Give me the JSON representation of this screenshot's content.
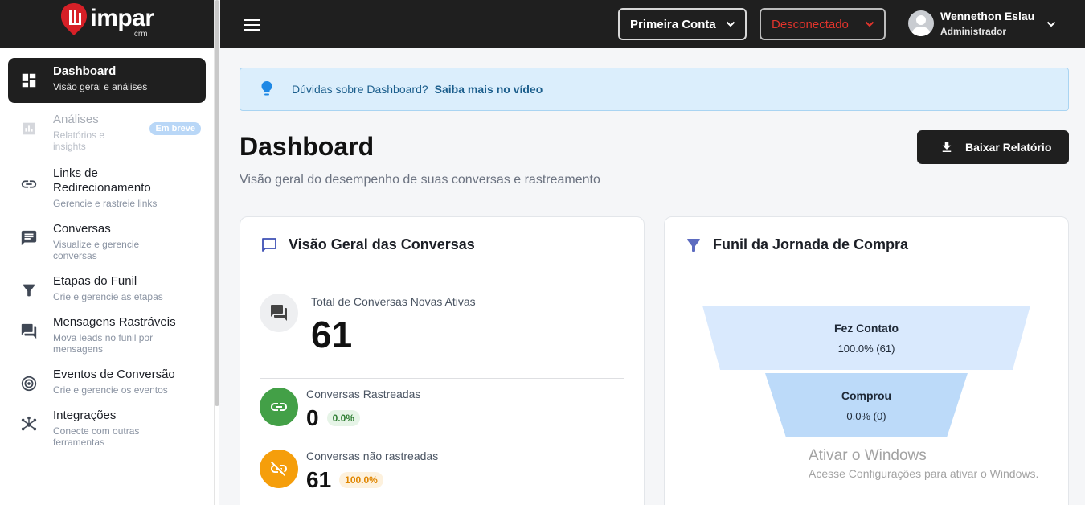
{
  "brand": {
    "name": "impar",
    "sub": "crm"
  },
  "sidebar": {
    "items": [
      {
        "title": "Dashboard",
        "sub": "Visão geral e análises",
        "icon": "dashboard-icon"
      },
      {
        "title": "Análises",
        "sub": "Relatórios e insights",
        "icon": "analytics-icon",
        "badge": "Em breve"
      },
      {
        "title": "Links de Redirecionamento",
        "sub": "Gerencie e rastreie links",
        "icon": "link-icon"
      },
      {
        "title": "Conversas",
        "sub": "Visualize e gerencie conversas",
        "icon": "chat-icon"
      },
      {
        "title": "Etapas do Funil",
        "sub": "Crie e gerencie as etapas",
        "icon": "filter-icon"
      },
      {
        "title": "Mensagens Rastráveis",
        "sub": "Mova leads no funil por mensagens",
        "icon": "forum-icon"
      },
      {
        "title": "Eventos de Conversão",
        "sub": "Crie e gerencie os eventos",
        "icon": "target-icon"
      },
      {
        "title": "Integrações",
        "sub": "Conecte com outras ferramentas",
        "icon": "hub-icon"
      }
    ]
  },
  "topbar": {
    "account": "Primeira Conta",
    "status": "Desconectado",
    "user_name": "Wennethon Eslau",
    "user_role": "Administrador"
  },
  "banner": {
    "text": "Dúvidas sobre Dashboard?",
    "link": "Saiba mais no vídeo"
  },
  "page": {
    "title": "Dashboard",
    "subtitle": "Visão geral do desempenho de suas conversas e rastreamento",
    "download_label": "Baixar Relatório"
  },
  "overview": {
    "title": "Visão Geral das Conversas",
    "total_label": "Total de Conversas Novas Ativas",
    "total_value": "61",
    "tracked_label": "Conversas Rastreadas",
    "tracked_value": "0",
    "tracked_pct": "0.0%",
    "untracked_label": "Conversas não rastreadas",
    "untracked_value": "61",
    "untracked_pct": "100.0%"
  },
  "funnel": {
    "title": "Funil da Jornada de Compra",
    "stages": [
      {
        "name": "Fez Contato",
        "value": "100.0% (61)"
      },
      {
        "name": "Comprou",
        "value": "0.0% (0)"
      }
    ]
  },
  "watermark": {
    "title": "Ativar o Windows",
    "sub": "Acesse Configurações para ativar o Windows."
  },
  "colors": {
    "accent_dark": "#1f1f1f",
    "status_red": "#e0342c",
    "banner_blue": "#dbeefc",
    "funnel_stage1": "#d9e9fd",
    "funnel_stage2": "#bcdaf9",
    "green": "#43a047",
    "orange": "#f59e0b"
  }
}
